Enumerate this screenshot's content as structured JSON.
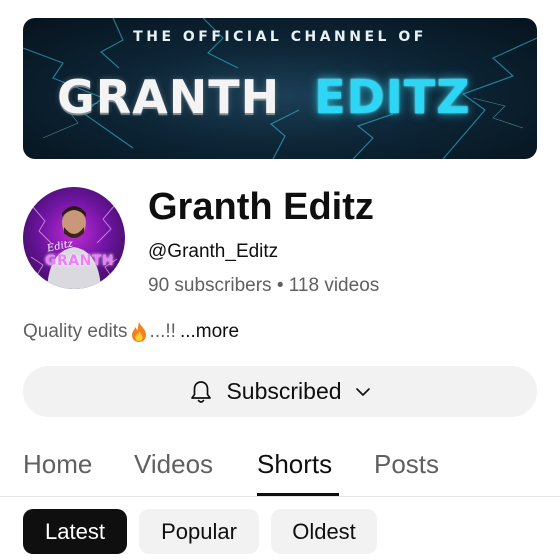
{
  "banner": {
    "tagline": "THE OFFICIAL CHANNEL OF",
    "logo_word1": "GRANTH",
    "logo_word2": "EDITZ"
  },
  "avatar": {
    "text_line1": "Editz",
    "text_line2": "GRANTH"
  },
  "channel": {
    "name": "Granth Editz",
    "handle": "@Granth_Editz",
    "stats": "90 subscribers • 118 videos"
  },
  "description": {
    "text": "Quality edits",
    "suffix": "...!!",
    "more": "...more",
    "emoji_icon": "fire-icon"
  },
  "subscribe": {
    "label": "Subscribed",
    "icon": "bell-icon",
    "dropdown_icon": "chevron-down-icon"
  },
  "tabs": [
    {
      "label": "Home",
      "active": false
    },
    {
      "label": "Videos",
      "active": false
    },
    {
      "label": "Shorts",
      "active": true
    },
    {
      "label": "Posts",
      "active": false
    }
  ],
  "filters": [
    {
      "label": "Latest",
      "active": true
    },
    {
      "label": "Popular",
      "active": false
    },
    {
      "label": "Oldest",
      "active": false
    }
  ],
  "colors": {
    "text_primary": "#0f0f0f",
    "text_secondary": "#606060",
    "chip_bg": "#f2f2f2",
    "banner_accent": "#2dd6f5",
    "avatar_accent": "#c02bd6"
  }
}
